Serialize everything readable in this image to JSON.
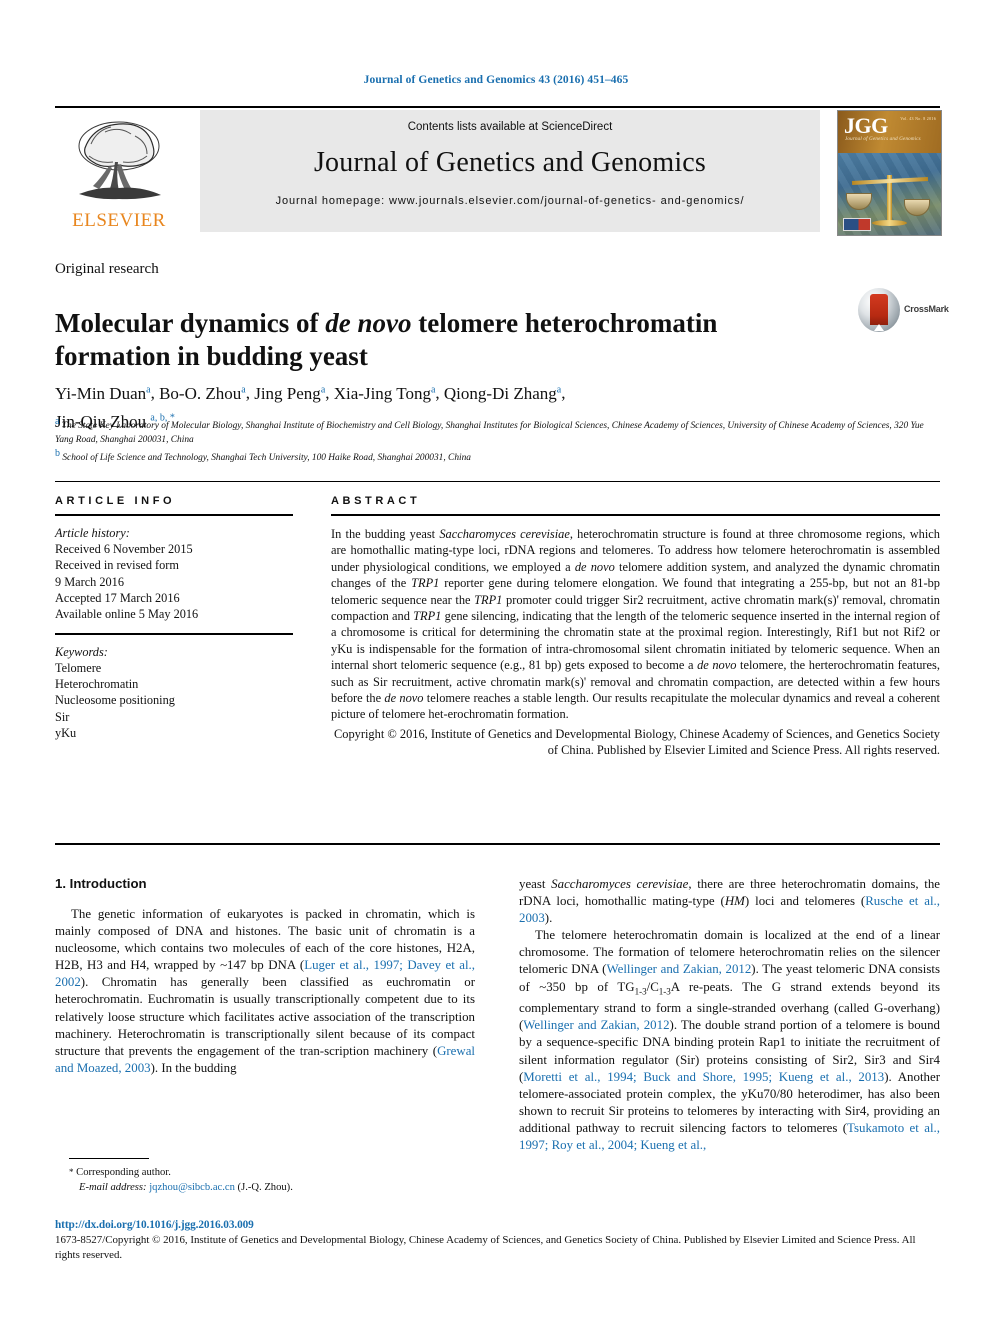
{
  "running_head": "Journal of Genetics and Genomics 43 (2016) 451–465",
  "header": {
    "publisher_logo_label": "ELSEVIER",
    "contents_line": "Contents lists available at ScienceDirect",
    "journal_title": "Journal of Genetics and Genomics",
    "homepage_line1": "Journal homepage: www.journals.elsevier.com/journal-of-genetics-",
    "homepage_line2": "and-genomics/",
    "cover": {
      "acronym": "JGG",
      "sub_title": "Journal of Genetics and Genomics",
      "issue_note": "Vol. 43  No. 8  2016"
    }
  },
  "article": {
    "type": "Original research",
    "title_part1": "Molecular dynamics of ",
    "title_italic": "de novo",
    "title_part2": " telomere heterochromatin formation in budding yeast",
    "crossmark_label": "CrossMark",
    "authors": [
      {
        "name": "Yi-Min Duan",
        "sup": "a"
      },
      {
        "name": "Bo-O. Zhou",
        "sup": "a"
      },
      {
        "name": "Jing Peng",
        "sup": "a"
      },
      {
        "name": "Xia-Jing Tong",
        "sup": "a"
      },
      {
        "name": "Qiong-Di Zhang",
        "sup": "a"
      },
      {
        "name": "Jin-Qiu Zhou",
        "sup": "a, b, *"
      }
    ],
    "affiliations": [
      {
        "mark": "a",
        "text": "The State Key Laboratory of Molecular Biology, Shanghai Institute of Biochemistry and Cell Biology, Shanghai Institutes for Biological Sciences, Chinese Academy of Sciences, University of Chinese Academy of Sciences, 320 Yue Yang Road, Shanghai 200031, China"
      },
      {
        "mark": "b",
        "text": "School of Life Science and Technology, Shanghai Tech University, 100 Haike Road, Shanghai 200031, China"
      }
    ]
  },
  "article_info": {
    "heading": "ARTICLE INFO",
    "history_label": "Article history:",
    "history": [
      "Received 6 November 2015",
      "Received in revised form",
      "9 March 2016",
      "Accepted 17 March 2016",
      "Available online 5 May 2016"
    ],
    "keywords_label": "Keywords:",
    "keywords": [
      "Telomere",
      "Heterochromatin",
      "Nucleosome positioning",
      "Sir",
      "yKu"
    ]
  },
  "abstract": {
    "heading": "ABSTRACT",
    "copyright": "Copyright © 2016, Institute of Genetics and Developmental Biology, Chinese Academy of Sciences, and Genetics Society of China. Published by Elsevier Limited and Science Press. All rights reserved."
  },
  "body": {
    "section_heading": "1.  Introduction",
    "footnote_corresponding": "Corresponding author.",
    "footnote_email_label": "E-mail address:",
    "footnote_email": "jqzhou@sibcb.ac.cn",
    "footnote_email_suffix": "(J.-Q. Zhou).",
    "doi": "http://dx.doi.org/10.1016/j.jgg.2016.03.009",
    "footer_copyright": "1673-8527/Copyright © 2016, Institute of Genetics and Developmental Biology, Chinese Academy of Sciences, and Genetics Society of China. Published by Elsevier Limited and Science Press. All rights reserved."
  },
  "colors": {
    "link_blue": "#1a6faf",
    "elsevier_orange": "#e8861e",
    "band_gray": "#e8e8e8"
  }
}
